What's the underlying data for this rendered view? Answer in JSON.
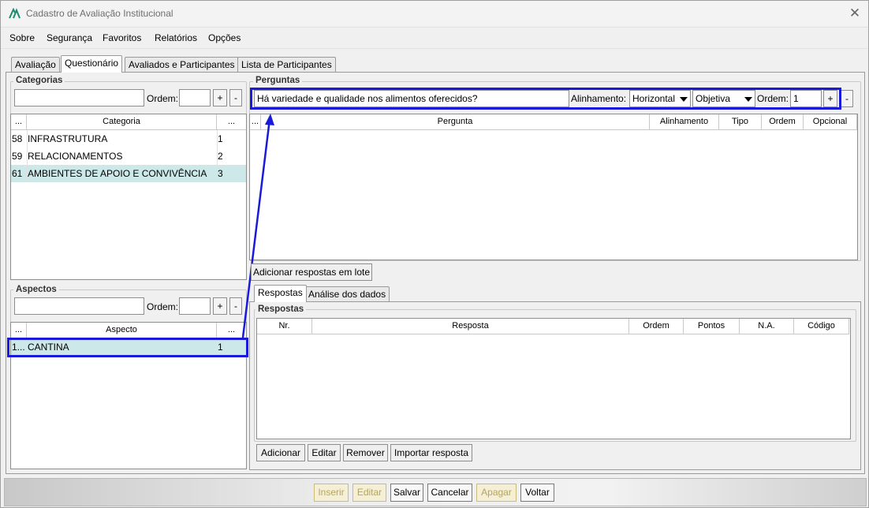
{
  "window": {
    "title": "Cadastro de Avaliação Institucional",
    "close_icon": "close-icon"
  },
  "menu": [
    "Sobre",
    "Segurança",
    "Favoritos",
    "Relatórios",
    "Opções"
  ],
  "tabs": [
    "Avaliação",
    "Questionário",
    "Avaliados e Participantes",
    "Lista de Participantes"
  ],
  "categorias": {
    "legend": "Categorias",
    "input_value": "",
    "ordem_label": "Ordem:",
    "ordem_value": "",
    "plus": "+",
    "minus": "-",
    "headers": [
      "...",
      "Categoria",
      "..."
    ],
    "rows": [
      {
        "id": "58",
        "name": "INFRASTRUTURA",
        "ord": "1"
      },
      {
        "id": "59",
        "name": "RELACIONAMENTOS",
        "ord": "2"
      },
      {
        "id": "61",
        "name": "AMBIENTES DE APOIO E CONVIVÊNCIA",
        "ord": "3"
      }
    ]
  },
  "aspectos": {
    "legend": "Aspectos",
    "input_value": "",
    "ordem_label": "Ordem:",
    "ordem_value": "",
    "plus": "+",
    "minus": "-",
    "headers": [
      "...",
      "Aspecto",
      "..."
    ],
    "rows": [
      {
        "id": "1...",
        "name": "CANTINA",
        "ord": "1"
      }
    ]
  },
  "perguntas": {
    "legend": "Perguntas",
    "question_value": "Há variedade e qualidade nos alimentos oferecidos?",
    "alinhamento_label": "Alinhamento:",
    "alinhamento_value": "Horizontal",
    "tipo_value": "Objetiva",
    "ordem_label": "Ordem:",
    "ordem_value": "1",
    "plus": "+",
    "minus": "-",
    "headers": [
      "...",
      "Pergunta",
      "Alinhamento",
      "Tipo",
      "Ordem",
      "Opcional"
    ],
    "batch_button": "Adicionar respostas em lote"
  },
  "subtabs": [
    "Respostas",
    "Análise dos dados"
  ],
  "respostas": {
    "legend": "Respostas",
    "headers": [
      "Nr.",
      "Resposta",
      "Ordem",
      "Pontos",
      "N.A.",
      "Código"
    ],
    "buttons": [
      "Adicionar",
      "Editar",
      "Remover",
      "Importar resposta"
    ]
  },
  "footer": {
    "buttons": [
      "Inserir",
      "Editar",
      "Salvar",
      "Cancelar",
      "Apagar",
      "Voltar"
    ]
  },
  "colors": {
    "highlight": "#1a1adb",
    "selected_row": "#cce8e8"
  }
}
